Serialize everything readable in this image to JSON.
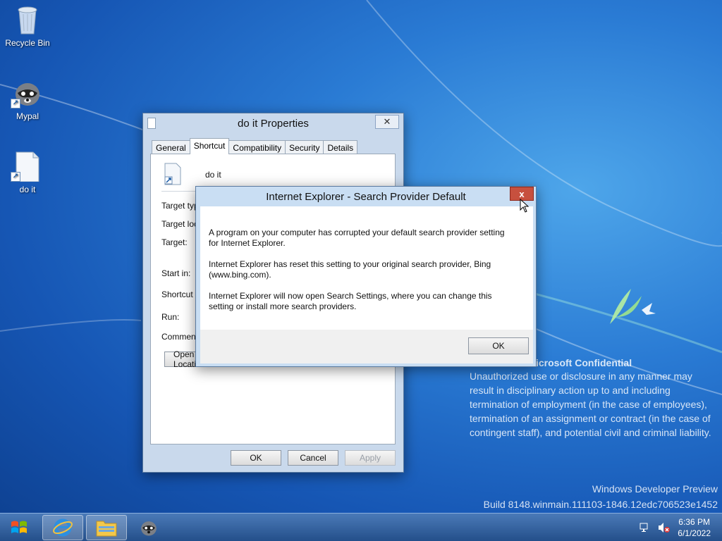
{
  "desktop": {
    "icons": [
      {
        "label": "Recycle Bin"
      },
      {
        "label": "Mypal"
      },
      {
        "label": "do it"
      }
    ],
    "watermark": {
      "confidential": "icrosoft Confidential",
      "body": "Unauthorized use or disclosure in any manner may result in disciplinary action up to and including termination of employment (in the case of employees), termination of an assignment or contract (in the case of contingent staff), and potential civil and criminal liability.",
      "build_line1": "Windows Developer Preview",
      "build_line2": "Build 8148.winmain.111103-1846.12edc706523e1452"
    }
  },
  "properties_window": {
    "title": "do it Properties",
    "tabs": [
      "General",
      "Shortcut",
      "Compatibility",
      "Security",
      "Details"
    ],
    "selected_tab": "Shortcut",
    "file_name": "do it",
    "fields": {
      "target_type": "Target type:",
      "target_location": "Target location:",
      "target": "Target:",
      "start_in": "Start in:",
      "shortcut_key": "Shortcut key:",
      "run": "Run:",
      "comment": "Comment:"
    },
    "open_file_location": "Open File Location",
    "buttons": {
      "ok": "OK",
      "cancel": "Cancel",
      "apply": "Apply"
    }
  },
  "ie_dialog": {
    "title": "Internet Explorer - Search Provider Default",
    "paragraphs": [
      "A program on your computer has corrupted your default search provider setting for Internet Explorer.",
      "Internet Explorer has reset this setting to your original search provider, Bing (www.bing.com).",
      "Internet Explorer will now open Search Settings, where you can change this setting or install more search providers."
    ],
    "ok_label": "OK",
    "close_label": "x"
  },
  "taskbar": {
    "time": "6:36 PM",
    "date": "6/1/2022"
  },
  "colors": {
    "desktop_blue": "#1f6bc8",
    "close_red": "#c7503e",
    "taskbar": "#2f5f9e"
  }
}
